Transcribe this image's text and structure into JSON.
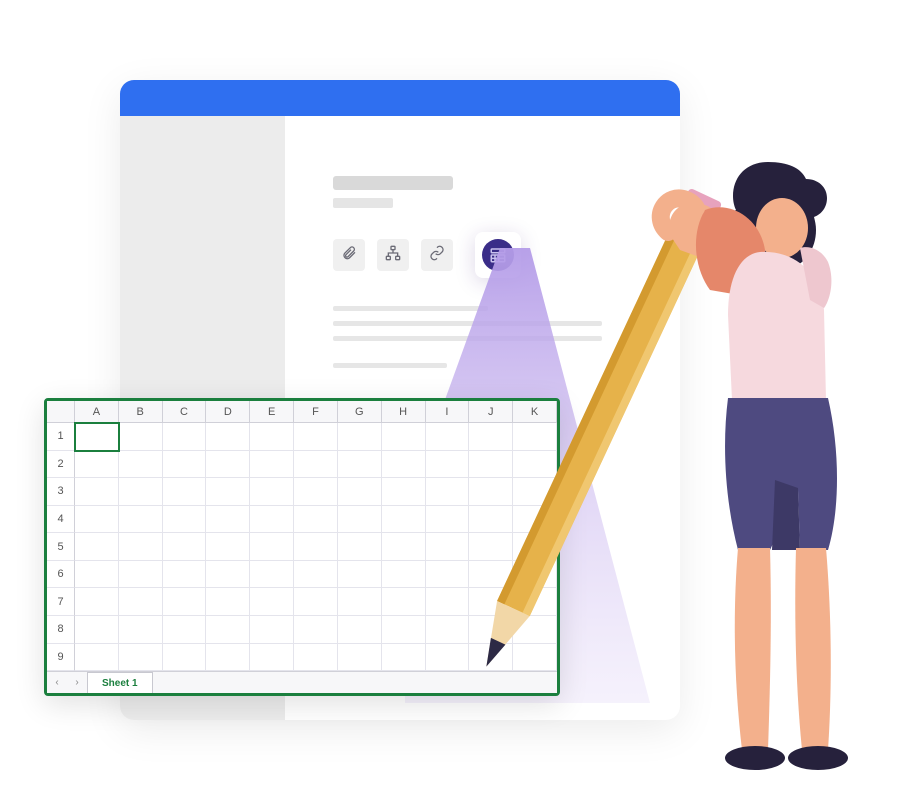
{
  "spreadsheet": {
    "columns": [
      "A",
      "B",
      "C",
      "D",
      "E",
      "F",
      "G",
      "H",
      "I",
      "J",
      "K"
    ],
    "rows": [
      "1",
      "2",
      "3",
      "4",
      "5",
      "6",
      "7",
      "8",
      "9"
    ],
    "sheet_tab": "Sheet 1",
    "nav_prev": "‹",
    "nav_next": "›"
  },
  "colors": {
    "green": "#1b7f3e",
    "blue": "#2f6ff0",
    "purple_beam": "#ad92e6",
    "purple_icon": "#3a2d88"
  }
}
